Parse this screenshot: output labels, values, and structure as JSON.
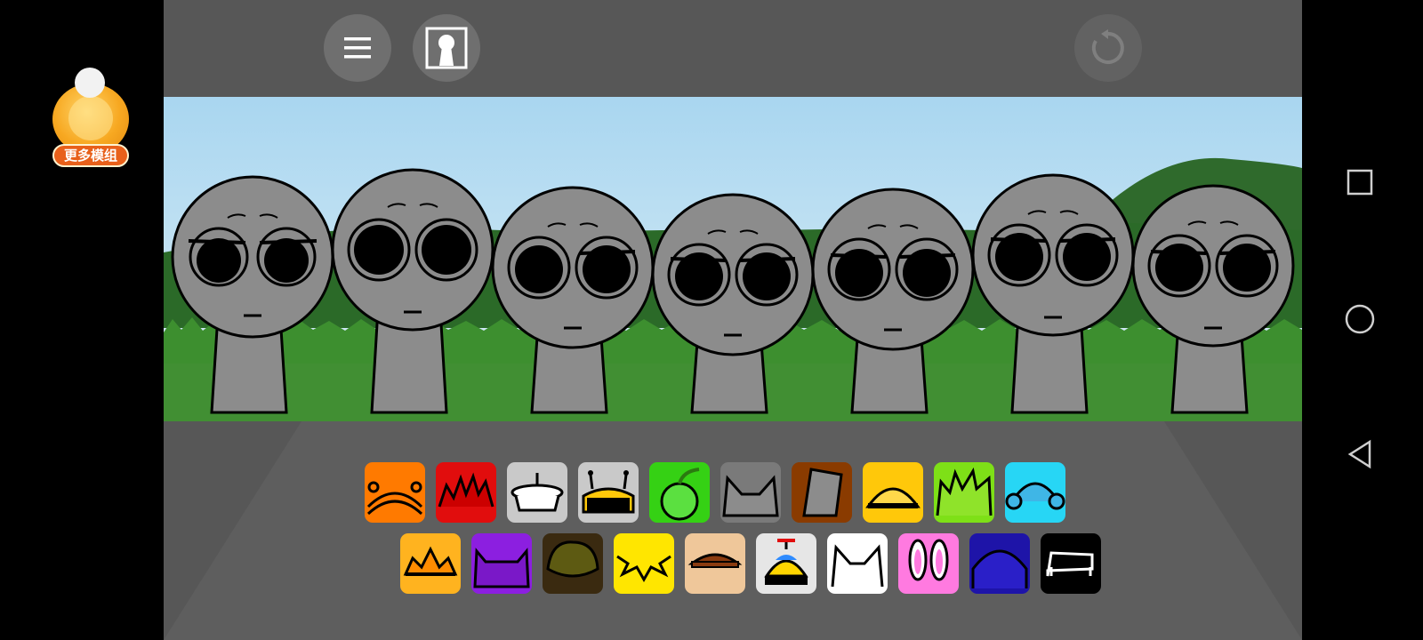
{
  "mod_badge": {
    "label": "更多模组"
  },
  "toolbar": {
    "menu_icon": "hamburger-menu-icon",
    "keyhole_icon": "keyhole-icon",
    "reset_icon": "reset-icon"
  },
  "characters": [
    {
      "slot": 1
    },
    {
      "slot": 2
    },
    {
      "slot": 3
    },
    {
      "slot": 4
    },
    {
      "slot": 5
    },
    {
      "slot": 6
    },
    {
      "slot": 7
    }
  ],
  "picker": {
    "row1": [
      {
        "name": "orange-antenna",
        "color": "#ff7a00"
      },
      {
        "name": "red-spikes",
        "color": "#e10d0d"
      },
      {
        "name": "white-pot",
        "color": "#c9c9c9"
      },
      {
        "name": "black-antenna-box",
        "color": "#c9c9c9"
      },
      {
        "name": "green-melon",
        "color": "#35d114"
      },
      {
        "name": "gray-cat-ears",
        "color": "#7a7a7a"
      },
      {
        "name": "brown-bucket",
        "color": "#8a3b00"
      },
      {
        "name": "yellow-helmet",
        "color": "#ffc80a"
      },
      {
        "name": "lime-spikes",
        "color": "#7ee017"
      },
      {
        "name": "cyan-headphones",
        "color": "#27d6f5"
      }
    ],
    "row2": [
      {
        "name": "orange-crown",
        "color": "#ffb31f"
      },
      {
        "name": "purple-horns",
        "color": "#8c1fe0"
      },
      {
        "name": "olive-hair",
        "color": "#3a2a10"
      },
      {
        "name": "yellow-lightning",
        "color": "#ffe600"
      },
      {
        "name": "brown-cap",
        "color": "#efc79a"
      },
      {
        "name": "propeller-hat",
        "color": "#e6e6e6"
      },
      {
        "name": "white-cat-ears",
        "color": "#ffffff"
      },
      {
        "name": "pink-bunny-ears",
        "color": "#ff7ae0"
      },
      {
        "name": "blue-hood",
        "color": "#1e14a8"
      },
      {
        "name": "black-box",
        "color": "#000000"
      }
    ]
  },
  "colors": {
    "sky_top": "#a9d6f0",
    "sky_bottom": "#d9ecf5",
    "grass": "#3d8f2f",
    "character_gray": "#8c8c8c",
    "panel_gray": "#575757"
  }
}
